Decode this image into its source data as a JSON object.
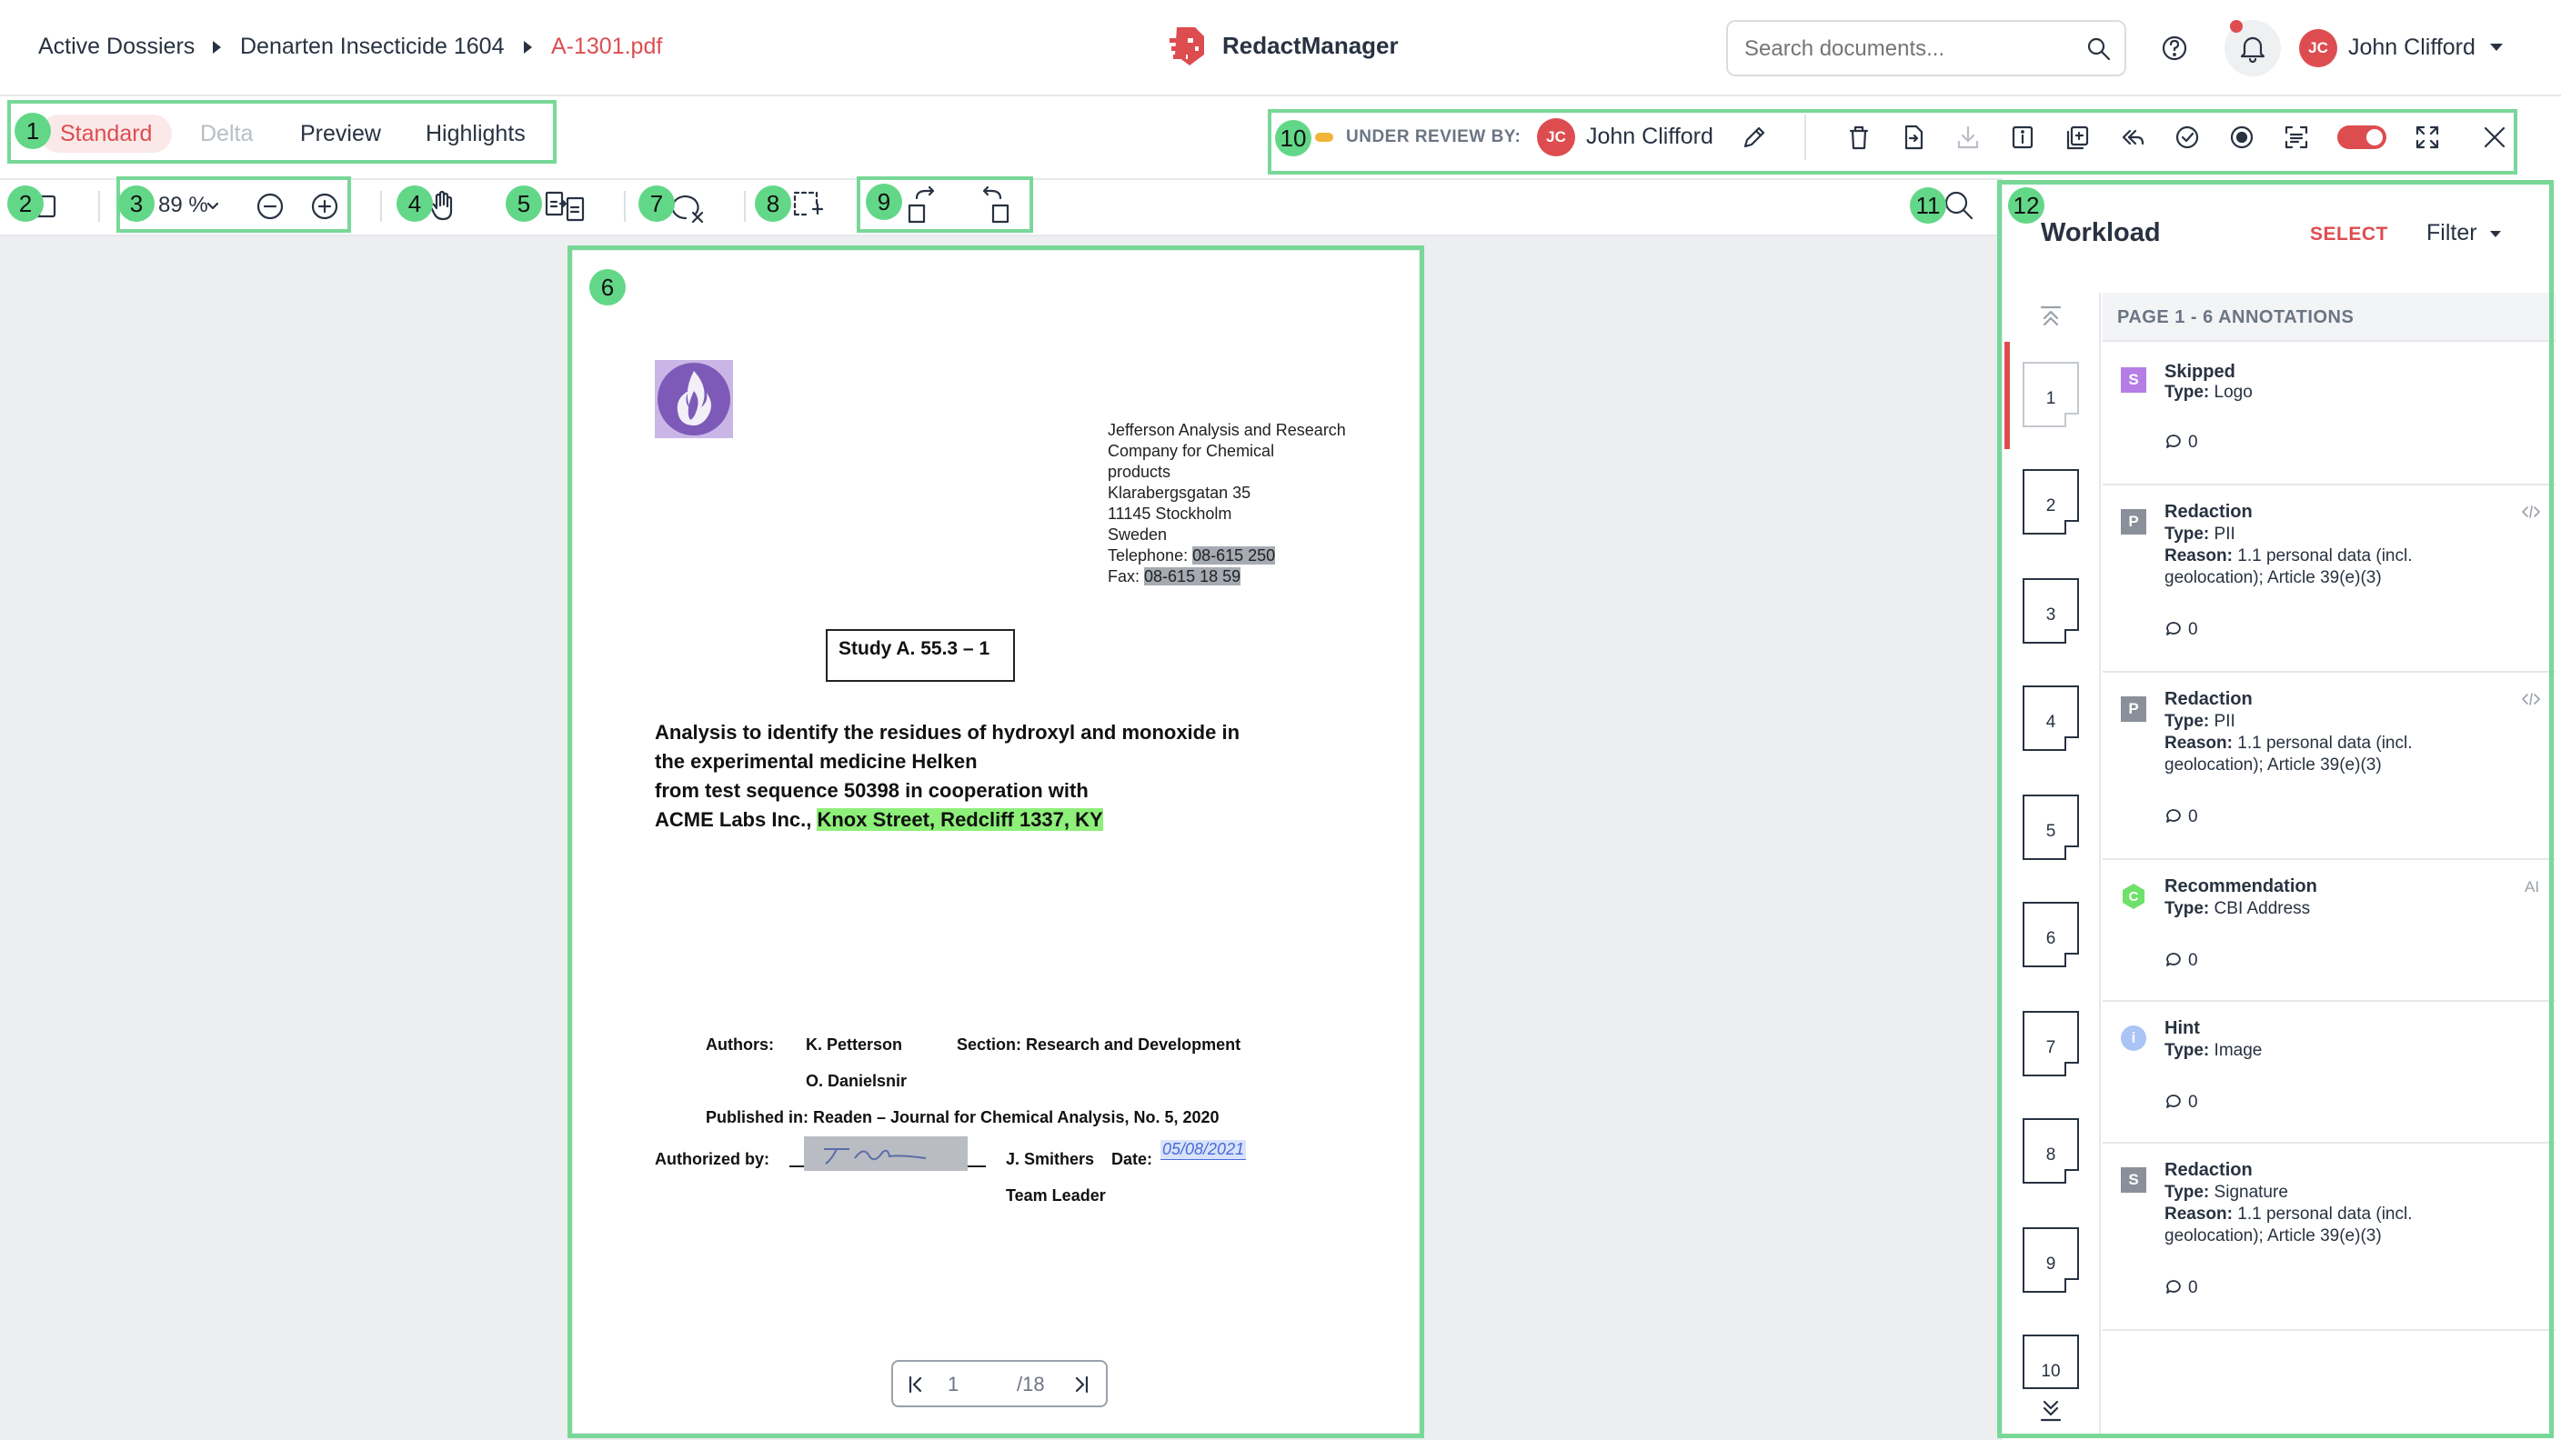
{
  "header": {
    "breadcrumb": [
      "Active Dossiers",
      "Denarten Insecticide 1604",
      "A-1301.pdf"
    ],
    "brand": "RedactManager",
    "search_placeholder": "Search documents...",
    "user": {
      "initials": "JC",
      "name": "John Clifford"
    }
  },
  "modes": [
    "Standard",
    "Delta",
    "Preview",
    "Highlights"
  ],
  "review": {
    "label": "UNDER REVIEW BY:",
    "initials": "JC",
    "name": "John Clifford"
  },
  "toolbar": {
    "zoom": "89 %"
  },
  "document": {
    "address": [
      "Jefferson Analysis and Research",
      "Company for Chemical",
      "products",
      "Klarabergsgatan 35",
      "11145 Stockholm",
      "Sweden"
    ],
    "telephone_label": "Telephone:",
    "telephone": "08-615 250",
    "fax_label": "Fax:",
    "fax": "08-615 18 59",
    "study": "Study A. 55.3 – 1",
    "title_lines": [
      "Analysis to identify the residues of hydroxyl and monoxide in",
      "the experimental medicine Helken",
      "from test sequence 50398 in cooperation with"
    ],
    "title_last_prefix": "ACME Labs Inc., ",
    "title_last_highlight": "Knox Street, Redcliff 1337, KY",
    "authors_label": "Authors:",
    "author1": "K. Petterson",
    "author2": "O. Danielsnir",
    "section": "Section: Research and Development",
    "published": "Published in: Readen – Journal for Chemical Analysis, No. 5, 2020",
    "authorized_label": "Authorized by:",
    "signer": "J. Smithers",
    "date_label": "Date:",
    "date_value": "05/08/2021",
    "role": "Team Leader",
    "page_current": "1",
    "page_total": "/18"
  },
  "panel": {
    "title": "Workload",
    "select": "SELECT",
    "filter": "Filter",
    "header": "PAGE 1 - 6 ANNOTATIONS",
    "thumbs": [
      "1",
      "2",
      "3",
      "4",
      "5",
      "6",
      "7",
      "8",
      "9",
      "10"
    ],
    "annotations": [
      {
        "letter": "S",
        "title": "Skipped",
        "type": "Logo",
        "reason": "",
        "count": "0",
        "color": "#b57ee6"
      },
      {
        "letter": "P",
        "title": "Redaction",
        "type": "PII",
        "reason": "1.1 personal data (incl. geolocation); Article 39(e)(3)",
        "count": "0",
        "color": "#8a9099"
      },
      {
        "letter": "P",
        "title": "Redaction",
        "type": "PII",
        "reason": "1.1 personal data (incl. geolocation); Article 39(e)(3)",
        "count": "0",
        "color": "#8a9099"
      },
      {
        "letter": "C",
        "title": "Recommendation",
        "type": "CBI Address",
        "reason": "",
        "count": "0",
        "color": "#6fe06a",
        "tag": "AI"
      },
      {
        "letter": "i",
        "title": "Hint",
        "type": "Image",
        "reason": "",
        "count": "0",
        "color": "#a9c4f5"
      },
      {
        "letter": "S",
        "title": "Redaction",
        "type": "Signature",
        "reason": "1.1 personal data (incl. geolocation); Article 39(e)(3)",
        "count": "0",
        "color": "#8a9099"
      }
    ],
    "type_label": "Type:",
    "reason_label": "Reason:"
  },
  "callouts": [
    "1",
    "2",
    "3",
    "4",
    "5",
    "6",
    "7",
    "8",
    "9",
    "10",
    "11",
    "12"
  ]
}
